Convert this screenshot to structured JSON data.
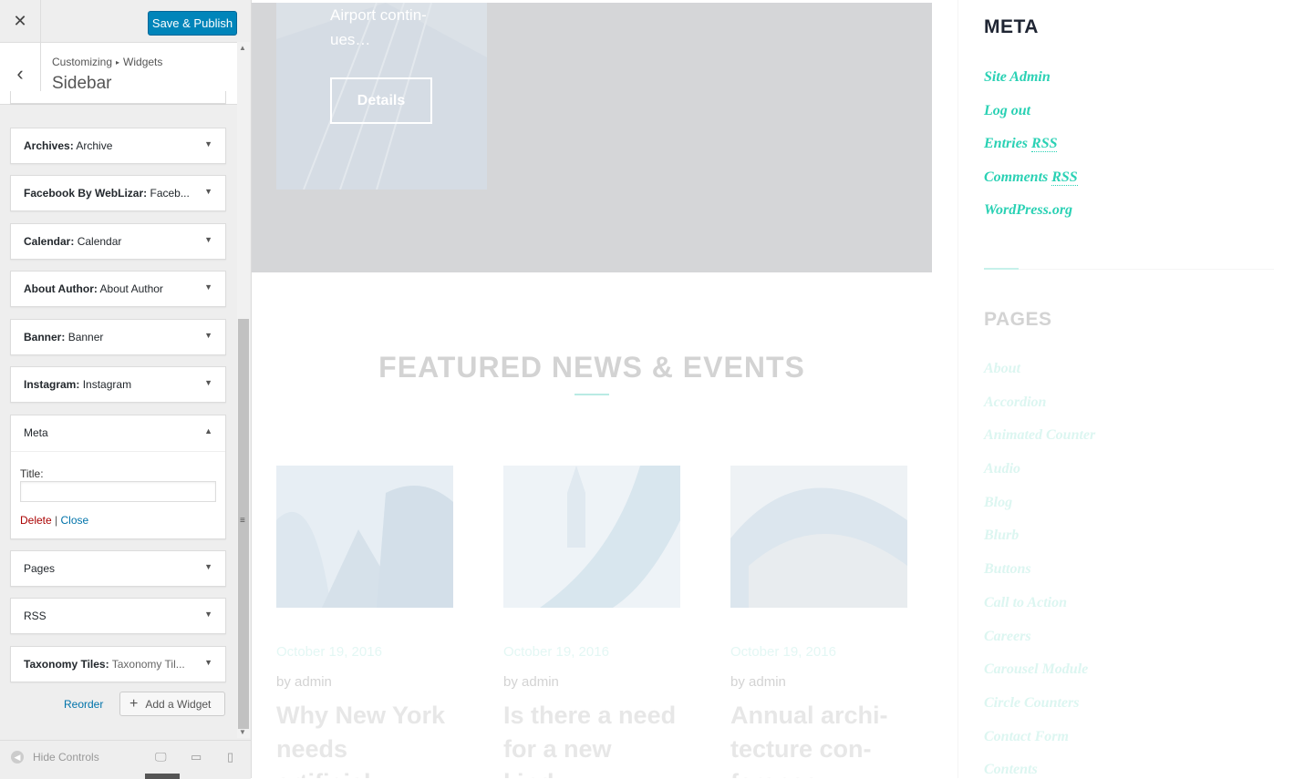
{
  "panel": {
    "close_icon": "close-icon",
    "save_label": "Save & Publish",
    "breadcrumb": [
      "Customizing",
      "Widgets"
    ],
    "breadcrumb_separator": "▸",
    "section_name": "Sidebar",
    "widgets": [
      {
        "type": "Archives:",
        "title": "Archive"
      },
      {
        "type": "Facebook By WebLizar:",
        "title": "Faceb..."
      },
      {
        "type": "Calendar:",
        "title": "Calendar"
      },
      {
        "type": "About Author:",
        "title": "About Author"
      },
      {
        "type": "Banner:",
        "title": "Banner"
      },
      {
        "type": "Instagram:",
        "title": "Instagram"
      },
      {
        "type": "Meta",
        "title": ""
      },
      {
        "type": "Pages",
        "title": ""
      },
      {
        "type": "RSS",
        "title": ""
      },
      {
        "type": "Taxonomy Tiles:",
        "title": "Taxonomy Til..."
      }
    ],
    "meta_form": {
      "title_label": "Title:",
      "title_value": "",
      "delete": "Delete",
      "sep": "|",
      "close": "Close"
    },
    "reorder_label": "Reorder",
    "add_widget_label": "Add a Widget",
    "hide_controls_label": "Hide Controls",
    "active_device": "desktop"
  },
  "preview": {
    "hero_excerpt": "Airport contin- ues…",
    "details_button": "Details",
    "featured_title": "FEATURED NEWS & EVENTS",
    "posts": [
      {
        "date": "October 19, 2016",
        "author": "by admin",
        "headline": "Why New York needs artificial..."
      },
      {
        "date": "October 19, 2016",
        "author": "by admin",
        "headline": "Is there a need for a new kind..."
      },
      {
        "date": "October 19, 2016",
        "author": "by admin",
        "headline": "Annual archi- tecture con- ference..."
      }
    ],
    "meta_heading": "META",
    "meta_links": [
      "Site Admin",
      "Log out",
      "Entries",
      "Comments",
      "WordPress.org"
    ],
    "rss_abbr": "RSS",
    "pages_heading": "PAGES",
    "pages_links": [
      "About",
      "Accordion",
      "Animated Counter",
      "Audio",
      "Blog",
      "Blurb",
      "Buttons",
      "Call to Action",
      "Careers",
      "Carousel Module",
      "Circle Counters",
      "Contact Form",
      "Contents"
    ]
  },
  "colors": {
    "accent": "#2ad1b4",
    "save_button": "#0085ba",
    "delete": "#aa0000",
    "link": "#0073aa"
  }
}
